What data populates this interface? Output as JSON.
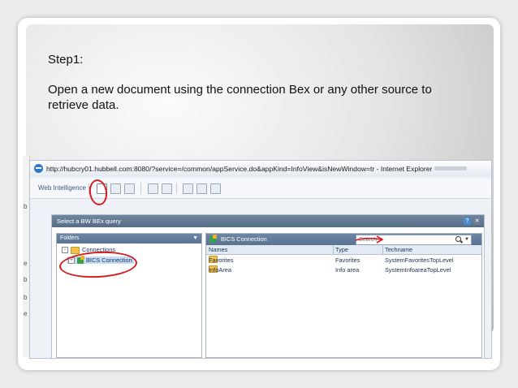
{
  "slide": {
    "step_label": "Step1:",
    "instruction": "Open a new document using the connection Bex or any other source to retrieve data."
  },
  "browser": {
    "title_bar": "http://hubcry01.hubbell.com:8080/?service=/common/appService.do&appKind=InfoView&isNewWindow=tr - Internet Explorer",
    "app_menu_label": "Web Intelligence ▾"
  },
  "dialog": {
    "title": "Select a BW BEx query",
    "help_label": "?",
    "close_label": "✕",
    "folders": {
      "header": "Folders",
      "tree": [
        {
          "label": "Connections",
          "toggle": "−",
          "level": 0
        },
        {
          "label": "BICS Connection",
          "toggle": "+",
          "level": 1,
          "selected": true
        }
      ]
    },
    "content": {
      "header": "BICS Connection",
      "search_placeholder": "Search",
      "columns": [
        "Names",
        "Type",
        "Techname"
      ],
      "rows": [
        [
          "Favorites",
          "Favorites",
          "SystemFavoritesTopLevel"
        ],
        [
          "InfoArea",
          "Info area",
          "SystemInfoareaTopLevel"
        ]
      ]
    }
  },
  "colors": {
    "annotation": "#d21d24",
    "panel_header": "#5a7392",
    "link_text": "#1b3a66"
  }
}
